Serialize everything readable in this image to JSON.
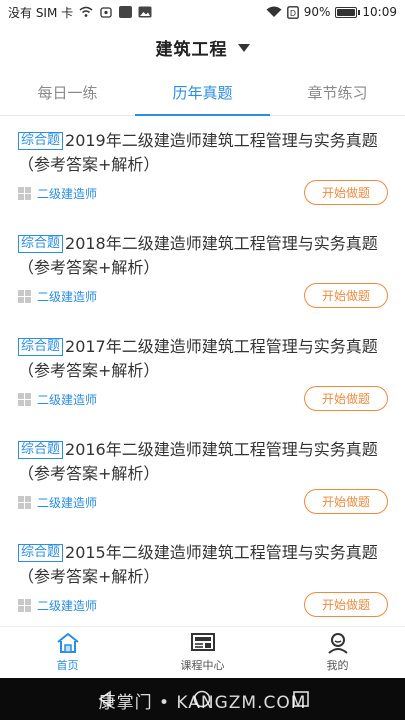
{
  "status_bar": {
    "carrier": "没有 SIM 卡",
    "battery": "90%",
    "battery_level": 0.9,
    "time": "10:09"
  },
  "header": {
    "title": "建筑工程"
  },
  "tabs": [
    {
      "label": "每日一练",
      "active": false
    },
    {
      "label": "历年真题",
      "active": true
    },
    {
      "label": "章节练习",
      "active": false
    }
  ],
  "items": [
    {
      "tag": "综合题",
      "title": "2019年二级建造师建筑工程管理与实务真题（参考答案+解析）",
      "category": "二级建造师",
      "button": "开始做题"
    },
    {
      "tag": "综合题",
      "title": "2018年二级建造师建筑工程管理与实务真题（参考答案+解析）",
      "category": "二级建造师",
      "button": "开始做题"
    },
    {
      "tag": "综合题",
      "title": "2017年二级建造师建筑工程管理与实务真题（参考答案+解析）",
      "category": "二级建造师",
      "button": "开始做题"
    },
    {
      "tag": "综合题",
      "title": "2016年二级建造师建筑工程管理与实务真题（参考答案+解析）",
      "category": "二级建造师",
      "button": "开始做题"
    },
    {
      "tag": "综合题",
      "title": "2015年二级建造师建筑工程管理与实务真题（参考答案+解析）",
      "category": "二级建造师",
      "button": "开始做题"
    }
  ],
  "bottom_nav": [
    {
      "label": "首页",
      "icon": "home-icon",
      "active": true
    },
    {
      "label": "课程中心",
      "icon": "course-icon",
      "active": false
    },
    {
      "label": "我的",
      "icon": "user-icon",
      "active": false
    }
  ],
  "watermark": "康掌门 • KANGZM.COM",
  "colors": {
    "accent": "#2a8ee6",
    "button": "#f08a3e"
  }
}
